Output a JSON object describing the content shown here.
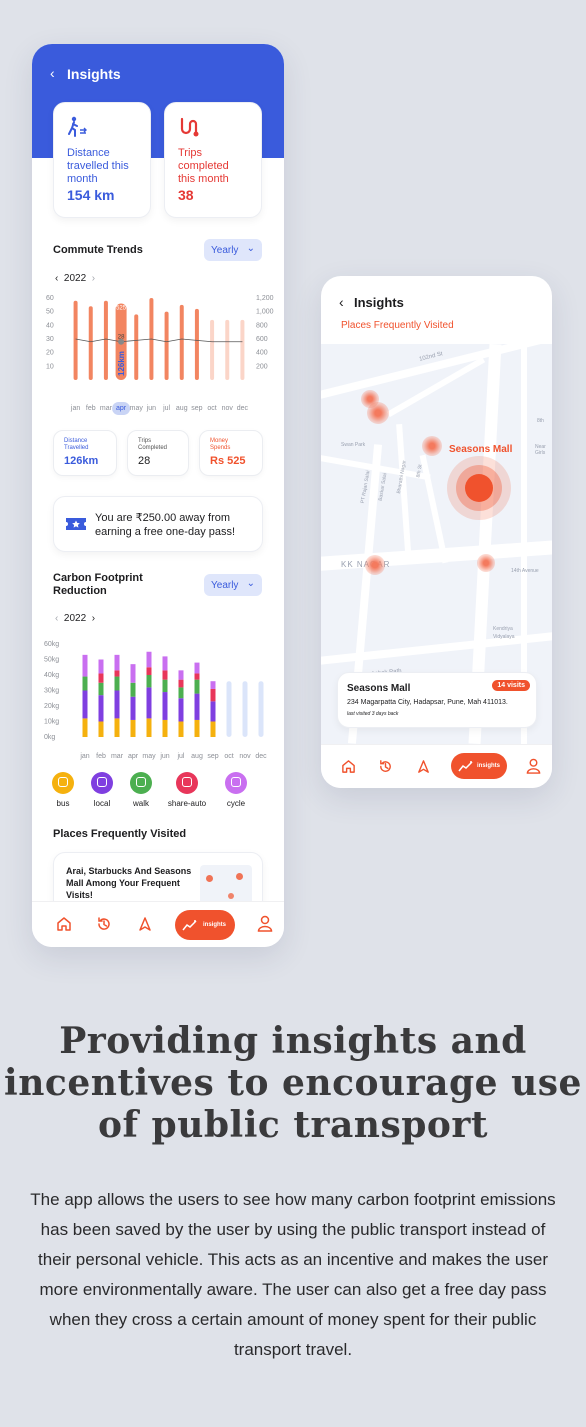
{
  "app": {
    "title": "Insights",
    "back_icon": "chevron-left-icon",
    "stats": [
      {
        "label": "Distance travelled this month",
        "value": "154 km",
        "icon": "walking-person-icon",
        "color": "#3a5bdc"
      },
      {
        "label": "Trips completed this month",
        "value": "38",
        "icon": "route-icon",
        "color": "#e53935"
      }
    ],
    "commute": {
      "title": "Commute Trends",
      "dropdown": "Yearly",
      "year": "2022",
      "active_label": "525",
      "active_avg": "28",
      "active_km": "126km",
      "summary": [
        {
          "label": "Distance Travelled",
          "value": "126km",
          "color": "#3a5bdc"
        },
        {
          "label": "Trips Completed",
          "value": "28",
          "color": "#1d1d1f"
        },
        {
          "label": "Money Spends",
          "value": "Rs 525",
          "color": "#f0522d"
        }
      ]
    },
    "pass": {
      "text": "You are ₹250.00 away from earning a free one-day pass!",
      "icon": "ticket-icon"
    },
    "carbon": {
      "title": "Carbon Footprint Reduction",
      "dropdown": "Yearly",
      "year": "2022",
      "legend": [
        {
          "label": "bus",
          "color": "#f5b10e",
          "icon": "bus-icon"
        },
        {
          "label": "local",
          "color": "#7f3fe0",
          "icon": "train-icon"
        },
        {
          "label": "walk",
          "color": "#4caf50",
          "icon": "walk-icon"
        },
        {
          "label": "share-auto",
          "color": "#e8365a",
          "icon": "auto-rickshaw-icon"
        },
        {
          "label": "cycle",
          "color": "#c96ff0",
          "icon": "bicycle-icon"
        }
      ]
    },
    "places": {
      "title": "Places Frequently Visited",
      "card_text": "Arai, Starbucks And Seasons Mall Among Your Frequent Visits!"
    },
    "nav": [
      {
        "name": "home",
        "icon": "home-icon"
      },
      {
        "name": "history",
        "icon": "history-icon"
      },
      {
        "name": "navigate",
        "icon": "navigate-icon"
      },
      {
        "name": "insights",
        "icon": "insights-icon",
        "label": "insights"
      },
      {
        "name": "profile",
        "icon": "user-icon"
      }
    ]
  },
  "map_screen": {
    "title": "Insights",
    "subtitle": "Places Frequently Visited",
    "map_labels": {
      "mall": "Seasons Mall",
      "kk_nagar": "KK NAGAR",
      "ashok": "Ashok Path",
      "road_102": "102nd St",
      "road_14": "14th Avenue",
      "park": "Swan Park",
      "pt_rajan": "PT Rajan Salai",
      "bharathi": "Bharathi Nagar",
      "mk": "8th St",
      "bheem": "Baskar Salai",
      "vid": "Vidyalaya",
      "kendriya": "Kendriya",
      "ninth": "8th",
      "near": "Near Girls"
    },
    "place_card": {
      "name": "Seasons Mall",
      "badge": "14 visits",
      "address": "234 Magarpatta City, Hadapsar, Pune, Mah 411013.",
      "last_visit": "last visited 3 days back"
    },
    "nav_active_label": "insights"
  },
  "chart_data": [
    {
      "type": "bar",
      "title": "Commute Trends",
      "categories": [
        "jan",
        "feb",
        "mar",
        "apr",
        "may",
        "jun",
        "jul",
        "aug",
        "sep",
        "oct",
        "nov",
        "dec"
      ],
      "series": [
        {
          "values": [
            58,
            54,
            58,
            56,
            48,
            60,
            50,
            55,
            52,
            44,
            44,
            44
          ]
        }
      ],
      "line": [
        30,
        28,
        30,
        28,
        29,
        30,
        28,
        30,
        29,
        28,
        28,
        28
      ],
      "left_ticks": [
        "60",
        "50",
        "40",
        "30",
        "20",
        "10"
      ],
      "right_ticks": [
        "1,200",
        "1,000",
        "800",
        "600",
        "400",
        "200"
      ],
      "highlight": "apr",
      "future_from": "oct",
      "ylim": [
        0,
        60
      ]
    },
    {
      "type": "bar",
      "title": "Carbon Footprint Reduction",
      "categories": [
        "jan",
        "feb",
        "mar",
        "apr",
        "may",
        "jun",
        "jul",
        "aug",
        "sep",
        "oct",
        "nov",
        "dec"
      ],
      "stack_order": [
        "bus",
        "local",
        "walk",
        "share-auto",
        "cycle"
      ],
      "values": [
        [
          12,
          18,
          9,
          0,
          14
        ],
        [
          10,
          17,
          8,
          6,
          9
        ],
        [
          12,
          18,
          9,
          4,
          10
        ],
        [
          11,
          15,
          9,
          0,
          12
        ],
        [
          12,
          20,
          8,
          5,
          10
        ],
        [
          11,
          18,
          8,
          6,
          9
        ],
        [
          10,
          15,
          7,
          5,
          6
        ],
        [
          11,
          17,
          9,
          4,
          7
        ],
        [
          10,
          13,
          0,
          8,
          5
        ],
        [
          36,
          0,
          0,
          0,
          0
        ],
        [
          36,
          0,
          0,
          0,
          0
        ],
        [
          36,
          0,
          0,
          0,
          0
        ]
      ],
      "future_from": "oct",
      "ticks": [
        "60kg",
        "50kg",
        "40kg",
        "30kg",
        "20kg",
        "10kg",
        "0kg"
      ],
      "ylim": [
        0,
        60
      ]
    }
  ],
  "marketing": {
    "headline": "Providing insights and incentives to encourage use of public transport",
    "body": "The app allows the users to see how many carbon footprint emissions has been saved by the user by using the public transport instead of their personal vehicle. This acts as an incentive and makes the user more environmentally aware. The user can also get a free day pass when they cross a certain amount of money spent for their public transport travel."
  }
}
